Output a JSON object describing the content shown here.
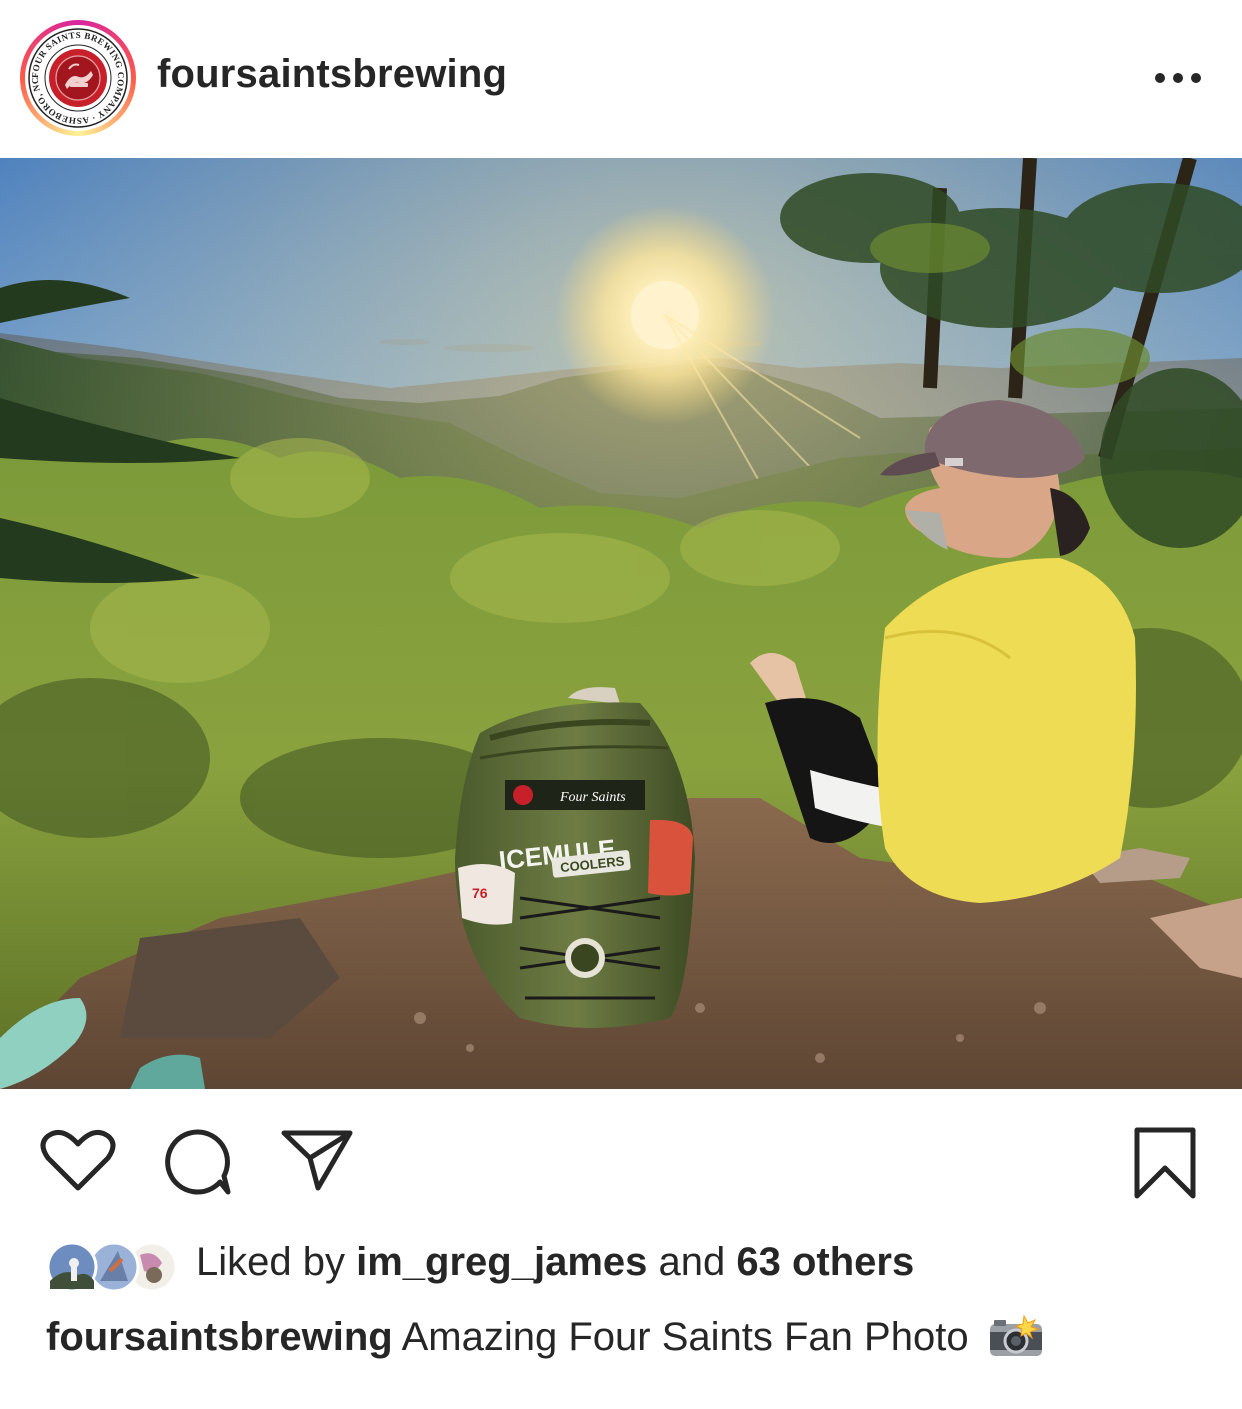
{
  "post": {
    "username": "foursaintsbrewing",
    "avatar_ring_text": "FOUR SAINTS BREWING COMPANY · ASHEBORO, NC ·",
    "more_icon": "more-horizontal-icon"
  },
  "photo": {
    "cooler_brand": "ICEMULE",
    "cooler_sub": "COOLERS",
    "cooler_logo": "Four Saints",
    "sticker_number": "76"
  },
  "actions": {
    "like_icon": "heart-icon",
    "comment_icon": "comment-icon",
    "share_icon": "send-icon",
    "save_icon": "bookmark-icon"
  },
  "likes": {
    "prefix": "Liked by ",
    "user": "im_greg_james",
    "middle": " and ",
    "others": "63 others"
  },
  "caption": {
    "user": "foursaintsbrewing",
    "text": " Amazing Four Saints Fan Photo",
    "emoji_icon": "camera-flash-icon"
  }
}
